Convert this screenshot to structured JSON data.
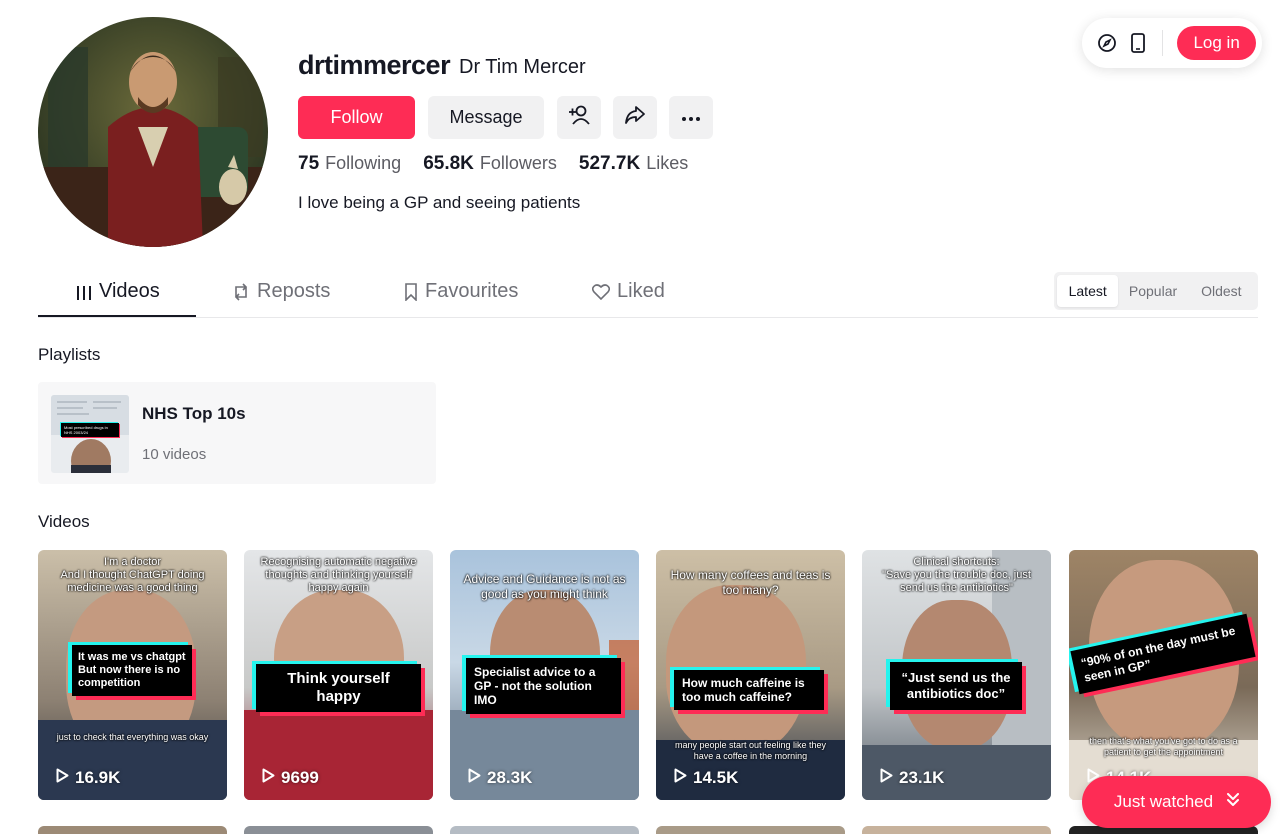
{
  "header": {
    "login_label": "Log in"
  },
  "profile": {
    "username": "drtimmercer",
    "display_name": "Dr Tim Mercer",
    "follow_label": "Follow",
    "message_label": "Message",
    "stats": [
      {
        "value": "75",
        "label": "Following"
      },
      {
        "value": "65.8K",
        "label": "Followers"
      },
      {
        "value": "527.7K",
        "label": "Likes"
      }
    ],
    "bio": "I love being a GP and seeing patients"
  },
  "tabs": [
    {
      "label": "Videos",
      "active": true
    },
    {
      "label": "Reposts"
    },
    {
      "label": "Favourites"
    },
    {
      "label": "Liked"
    }
  ],
  "sort": [
    "Latest",
    "Popular",
    "Oldest"
  ],
  "playlists": {
    "title": "Playlists",
    "items": [
      {
        "name": "NHS Top 10s",
        "count": "10 videos",
        "thumb_text": "Most prescribed drugs in NHS 2003/24"
      }
    ]
  },
  "videos": {
    "title": "Videos",
    "items": [
      {
        "top": "I'm a doctor\nAnd I thought ChatGPT doing medicine was a good thing",
        "caption": "It was me vs chatgpt\nBut now there is no competition",
        "bottom": "just to check that everything was okay",
        "views": "16.9K"
      },
      {
        "top": "Recognising automatic negative thoughts and thinking yourself happy again",
        "caption": "Think yourself happy",
        "bottom": "",
        "views": "9699"
      },
      {
        "top": "Advice and Guidance is not as good as you might think",
        "caption": "Specialist advice to a GP - not the solution IMO",
        "bottom": "",
        "views": "28.3K"
      },
      {
        "top": "How many coffees and teas is too many?",
        "caption": "How much caffeine is too much caffeine?",
        "bottom": "many people start out feeling like they have a coffee in the morning",
        "views": "14.5K"
      },
      {
        "top": "Clinical shortcuts:\n\"Save you the trouble doc, just send us the antibiotics\"",
        "caption": "“Just send us the antibiotics doc”",
        "bottom": "",
        "views": "23.1K"
      },
      {
        "top": "",
        "caption": "“90% of on the day must be seen in GP”",
        "bottom": "then that's what you've got to do as a patient to get the appointment",
        "views": "14.1K"
      }
    ]
  },
  "just_watched_label": "Just watched",
  "colors": {
    "accent": "#fe2c55",
    "cyan": "#25f4ee",
    "text": "#161823"
  }
}
